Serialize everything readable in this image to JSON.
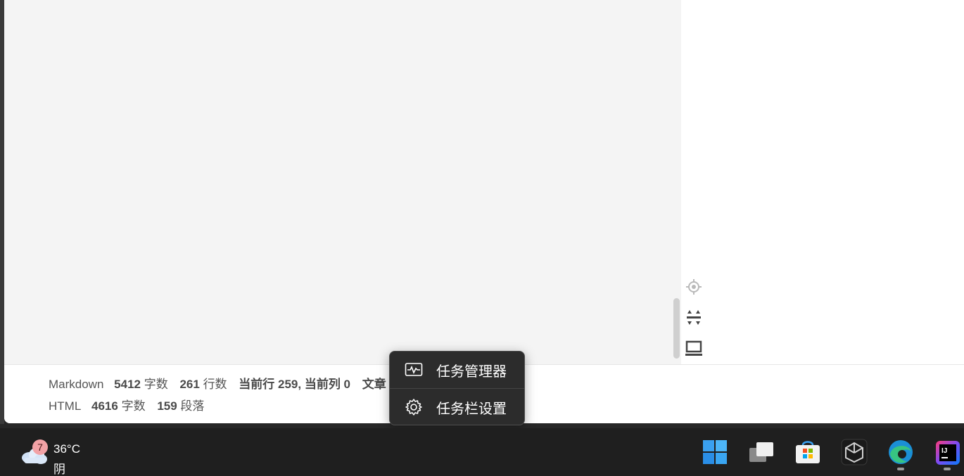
{
  "status_bar": {
    "row1": {
      "type_label": "Markdown",
      "chars_value": "5412",
      "chars_unit": "字数",
      "lines_value": "261",
      "lines_unit": "行数",
      "cursor": "当前行 259, 当前列 0",
      "article_trunc": "文章"
    },
    "row2": {
      "type_label": "HTML",
      "chars_value": "4616",
      "chars_unit": "字数",
      "paras_value": "159",
      "paras_unit": "段落"
    }
  },
  "context_menu": {
    "items": [
      {
        "label": "任务管理器",
        "icon": "task-manager-icon"
      },
      {
        "label": "任务栏设置",
        "icon": "gear-icon"
      }
    ]
  },
  "side_tools": [
    {
      "icon": "locate-crosshair-icon"
    },
    {
      "icon": "sync-scroll-icon"
    },
    {
      "icon": "laptop-preview-icon"
    }
  ],
  "taskbar": {
    "weather": {
      "badge": "7",
      "temperature": "36°C",
      "condition": "阴"
    },
    "apps": [
      {
        "icon": "windows-start-icon"
      },
      {
        "icon": "task-view-icon"
      },
      {
        "icon": "microsoft-store-icon"
      },
      {
        "icon": "unity-hub-icon"
      },
      {
        "icon": "edge-browser-icon"
      },
      {
        "icon": "intellij-idea-icon"
      }
    ]
  },
  "colors": {
    "editor_bg": "#f4f4f4",
    "menu_bg": "#2c2c2c",
    "taskbar_bg": "#1f1f1f",
    "badge_bg": "#f2a2a6"
  }
}
